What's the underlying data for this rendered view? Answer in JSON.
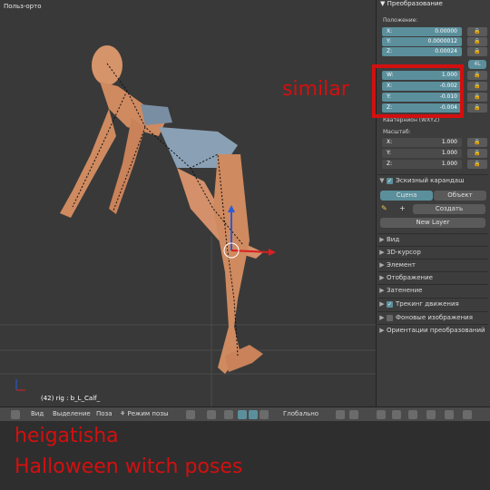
{
  "viewport": {
    "title": "Польз-орто",
    "status": "(42) rig : b_L_Calf_"
  },
  "panel": {
    "header": "Преобразование",
    "position_label": "Положение:",
    "location": [
      {
        "k": "X:",
        "v": "0.00000"
      },
      {
        "k": "Y:",
        "v": "0.0000012"
      },
      {
        "k": "Z:",
        "v": "0.00024"
      }
    ],
    "rotation_mode_badge": "4L",
    "rotation": [
      {
        "k": "W:",
        "v": "1.000"
      },
      {
        "k": "X:",
        "v": "-0.002"
      },
      {
        "k": "Y:",
        "v": "-0.010"
      },
      {
        "k": "Z:",
        "v": "-0.004"
      }
    ],
    "quaternion_label": "Кватернион (WXYZ)",
    "scale_label": "Масштаб:",
    "scale": [
      {
        "k": "X:",
        "v": "1.000"
      },
      {
        "k": "Y:",
        "v": "1.000"
      },
      {
        "k": "Z:",
        "v": "1.000"
      }
    ],
    "grease_pencil": "Эскизный карандаш",
    "tab_scene": "Сцена",
    "tab_object": "Объект",
    "create": "Создать",
    "new_layer": "New Layer",
    "sections": [
      "Вид",
      "3D-курсор",
      "Элемент",
      "Отображение",
      "Затенение"
    ],
    "motion_tracking": "Трекинг движения",
    "background_images": "Фоновые изображения",
    "transform_orientations": "Ориентации преобразований"
  },
  "annotation": {
    "similar": "similar"
  },
  "toolbar": {
    "view": "Вид",
    "select": "Выделение",
    "pose": "Поза",
    "mode": "Режим позы",
    "orientation": "Глобально"
  },
  "watermark": {
    "line1": "heigatisha",
    "line2": "Halloween witch poses"
  },
  "colors": {
    "accent": "#5b8f9c",
    "annotation_red": "#d40f0f",
    "grid": "#393939"
  }
}
